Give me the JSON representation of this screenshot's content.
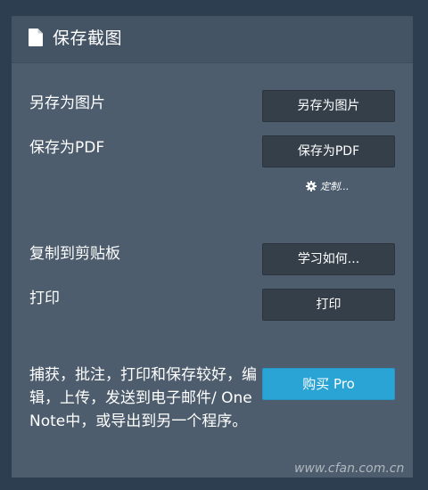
{
  "header": {
    "title": "保存截图",
    "icon": "document-icon"
  },
  "actions": {
    "save_image_label": "另存为图片",
    "save_image_button": "另存为图片",
    "save_pdf_label": "保存为PDF",
    "save_pdf_button": "保存为PDF",
    "customize_link": "定制...",
    "copy_label": "复制到剪贴板",
    "copy_button": "学习如何...",
    "print_label": "打印",
    "print_button": "打印"
  },
  "promo": {
    "description": "捕获，批注，打印和保存较好，编辑，上传，发送到电子邮件/ OneNote中，或导出到另一个程序。",
    "buy_button": "购买 Pro"
  },
  "watermark": "www.cfan.com.cn",
  "colors": {
    "background": "#2d3e50",
    "panel": "#4d5d6d",
    "button": "#353f49",
    "accent": "#2aa4d5"
  }
}
